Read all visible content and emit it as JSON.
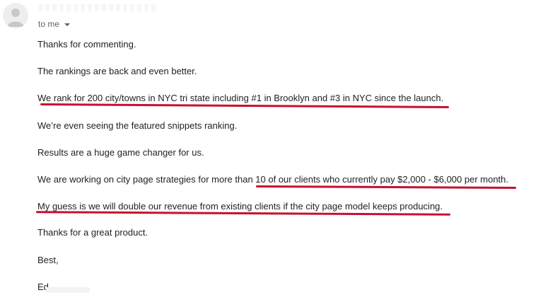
{
  "header": {
    "recipient_label": "to me"
  },
  "email": {
    "lines": [
      "Thanks for commenting.",
      "The rankings are back and even better.",
      "We rank for 200 city/towns in NYC tri state including #1 in Brooklyn and #3 in NYC since the launch.",
      "We’re even seeing the featured snippets ranking.",
      "Results are a huge game changer for us.",
      "We are working on city page strategies for more than 10 of our clients who currently pay $2,000 - $6,000 per month.",
      "My guess is we will double our revenue from existing clients if the city page model keeps producing.",
      "Thanks for a great product.",
      "Best,",
      "Ed"
    ]
  },
  "colors": {
    "highlight_underline": "#c8102e",
    "body_text": "#222222",
    "meta_text": "#5f6368"
  }
}
